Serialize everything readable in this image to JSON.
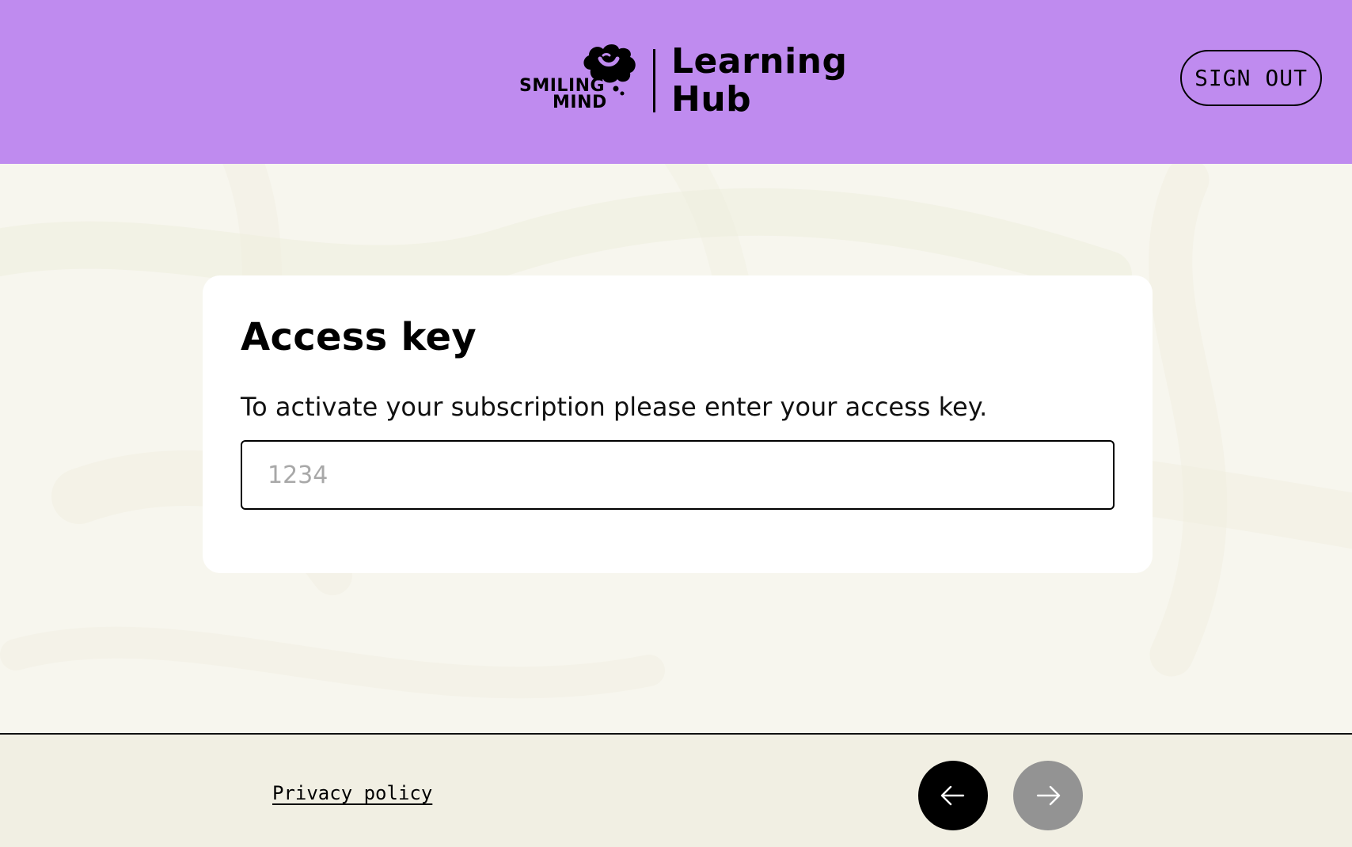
{
  "header": {
    "brand_line1": "SMILING",
    "brand_line2": "MIND",
    "title_line1": "Learning",
    "title_line2": "Hub",
    "sign_out_label": "SIGN OUT",
    "background_color": "#bf8bef"
  },
  "card": {
    "title": "Access key",
    "description": "To activate your subscription please enter your access key.",
    "input": {
      "value": "",
      "placeholder": "1234"
    }
  },
  "footer": {
    "privacy_label": "Privacy policy",
    "back_icon": "arrow-left-icon",
    "next_icon": "arrow-right-icon",
    "next_disabled_color": "#939393"
  }
}
